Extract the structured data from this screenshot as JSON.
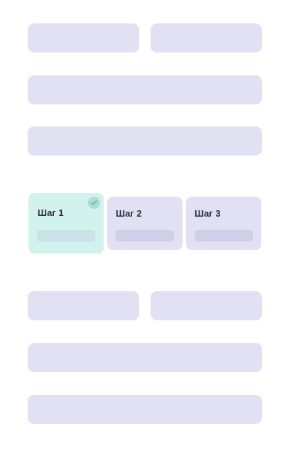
{
  "steps": [
    {
      "label": "Шаг 1",
      "state": "completed",
      "status_icon": "check-icon"
    },
    {
      "label": "Шаг 2",
      "state": "upcoming"
    },
    {
      "label": "Шаг 3",
      "state": "upcoming"
    }
  ],
  "colors": {
    "placeholder": "#e1e1f3",
    "placeholder_inner": "#cfcfe8",
    "active_step": "#d2f2ee",
    "active_check": "#a8ddd4",
    "text": "#2c2c3a"
  }
}
